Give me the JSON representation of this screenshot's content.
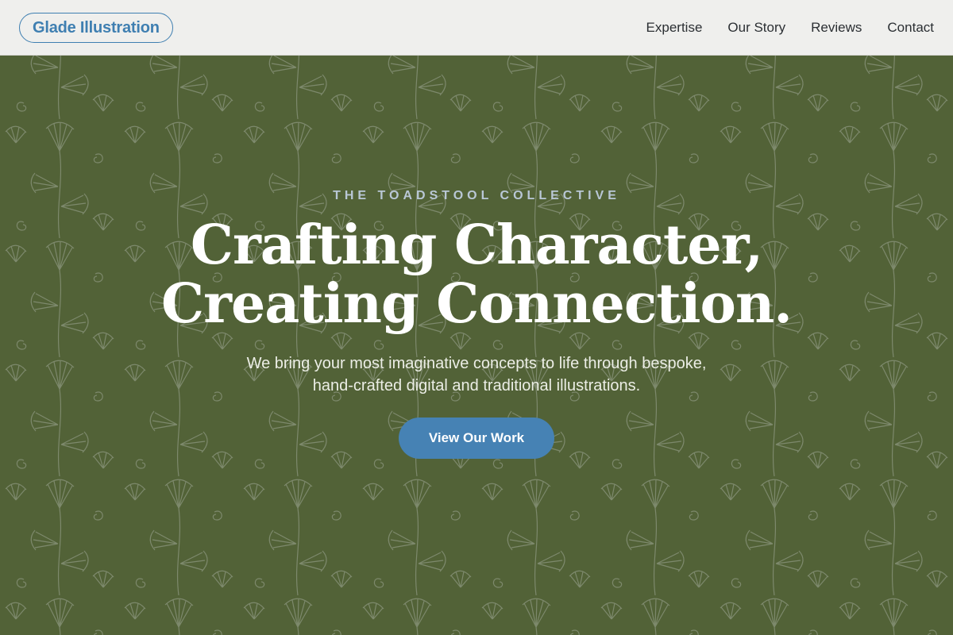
{
  "header": {
    "logo": "Glade Illustration",
    "nav": [
      {
        "label": "Expertise"
      },
      {
        "label": "Our Story"
      },
      {
        "label": "Reviews"
      },
      {
        "label": "Contact"
      }
    ]
  },
  "hero": {
    "eyebrow": "THE TOADSTOOL COLLECTIVE",
    "headline_line1": "Crafting Character,",
    "headline_line2": "Creating Connection.",
    "subtext_line1": "We bring your most imaginative concepts to life through bespoke,",
    "subtext_line2": "hand-crafted digital and traditional illustrations.",
    "cta_label": "View Our Work"
  },
  "colors": {
    "accent": "#4682b4",
    "background": "#5b6c3d",
    "header_bg": "#efefed"
  }
}
